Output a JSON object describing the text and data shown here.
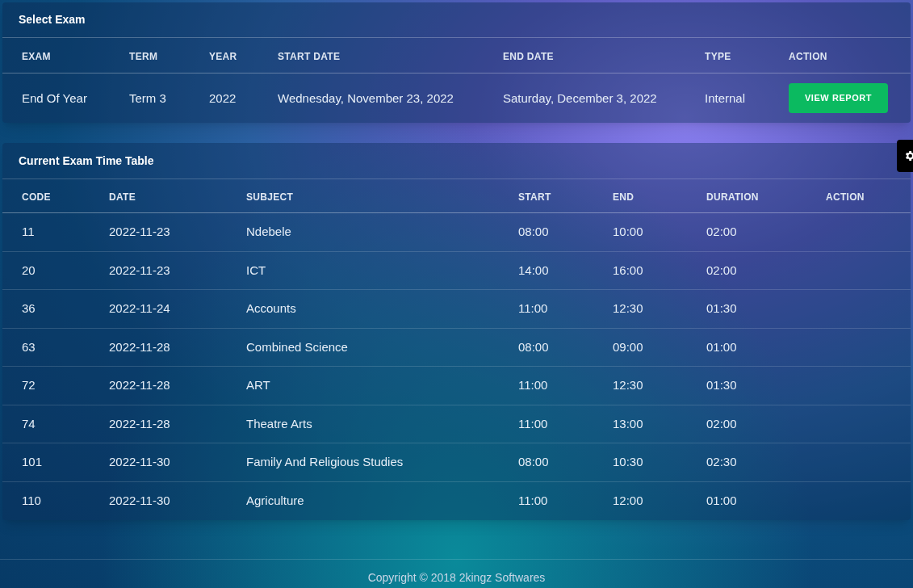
{
  "select_exam": {
    "title": "Select Exam",
    "columns": [
      "EXAM",
      "TERM",
      "YEAR",
      "START DATE",
      "END DATE",
      "TYPE",
      "ACTION"
    ],
    "row": {
      "exam": "End Of Year",
      "term": "Term 3",
      "year": "2022",
      "start_date": "Wednesday, November 23, 2022",
      "end_date": "Saturday, December 3, 2022",
      "type": "Internal",
      "action": "VIEW REPORT"
    }
  },
  "timetable": {
    "title": "Current Exam Time Table",
    "columns": [
      "CODE",
      "DATE",
      "SUBJECT",
      "START",
      "END",
      "DURATION",
      "ACTION"
    ],
    "rows": [
      {
        "code": "11",
        "date": "2022-11-23",
        "subject": "Ndebele",
        "start": "08:00",
        "end": "10:00",
        "duration": "02:00"
      },
      {
        "code": "20",
        "date": "2022-11-23",
        "subject": "ICT",
        "start": "14:00",
        "end": "16:00",
        "duration": "02:00"
      },
      {
        "code": "36",
        "date": "2022-11-24",
        "subject": "Accounts",
        "start": "11:00",
        "end": "12:30",
        "duration": "01:30"
      },
      {
        "code": "63",
        "date": "2022-11-28",
        "subject": "Combined Science",
        "start": "08:00",
        "end": "09:00",
        "duration": "01:00"
      },
      {
        "code": "72",
        "date": "2022-11-28",
        "subject": "ART",
        "start": "11:00",
        "end": "12:30",
        "duration": "01:30"
      },
      {
        "code": "74",
        "date": "2022-11-28",
        "subject": "Theatre Arts",
        "start": "11:00",
        "end": "13:00",
        "duration": "02:00"
      },
      {
        "code": "101",
        "date": "2022-11-30",
        "subject": "Family And Religious Studies",
        "start": "08:00",
        "end": "10:30",
        "duration": "02:30"
      },
      {
        "code": "110",
        "date": "2022-11-30",
        "subject": "Agriculture",
        "start": "11:00",
        "end": "12:00",
        "duration": "01:00"
      }
    ]
  },
  "footer": "Copyright © 2018 2kingz Softwares"
}
